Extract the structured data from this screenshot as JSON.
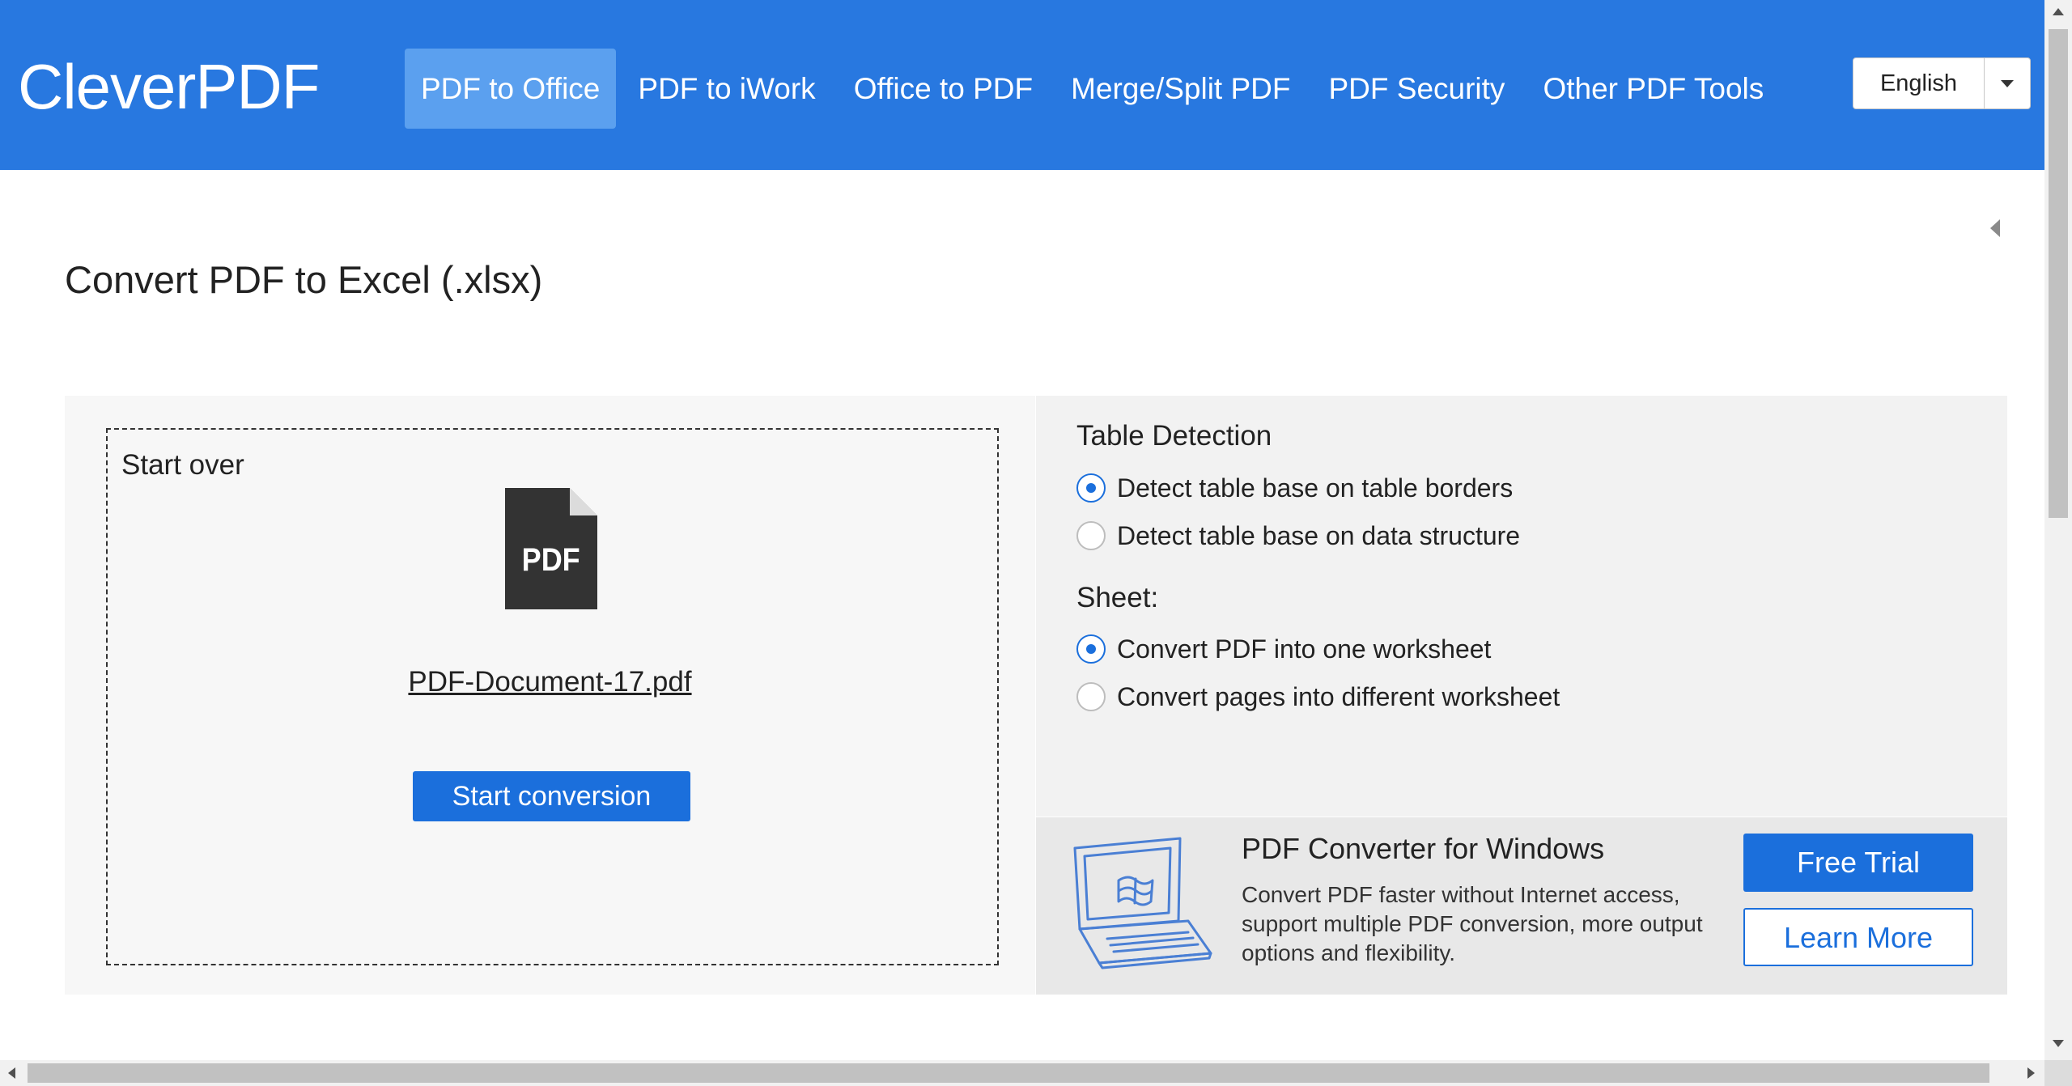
{
  "header": {
    "logo": "CleverPDF",
    "nav": [
      {
        "label": "PDF to Office",
        "active": true
      },
      {
        "label": "PDF to iWork",
        "active": false
      },
      {
        "label": "Office to PDF",
        "active": false
      },
      {
        "label": "Merge/Split PDF",
        "active": false
      },
      {
        "label": "PDF Security",
        "active": false
      },
      {
        "label": "Other PDF Tools",
        "active": false
      }
    ],
    "language": "English",
    "background_color": "#2878e0"
  },
  "page": {
    "title": "Convert PDF to Excel (.xlsx)"
  },
  "upload": {
    "start_over": "Start over",
    "file_icon_label": "PDF",
    "filename": "PDF-Document-17.pdf",
    "start_button": "Start conversion"
  },
  "options": {
    "table_detection": {
      "title": "Table Detection",
      "choices": [
        {
          "label": "Detect table base on table borders",
          "checked": true
        },
        {
          "label": "Detect table base on data structure",
          "checked": false
        }
      ]
    },
    "sheet": {
      "title": "Sheet:",
      "choices": [
        {
          "label": "Convert PDF into one worksheet",
          "checked": true
        },
        {
          "label": "Convert pages into different worksheet",
          "checked": false
        }
      ]
    }
  },
  "promo": {
    "title": "PDF Converter for Windows",
    "description": "Convert PDF faster without Internet access, support multiple PDF conversion, more output options and flexibility.",
    "free_trial": "Free Trial",
    "learn_more": "Learn More"
  },
  "colors": {
    "accent": "#1b6fdc",
    "nav_active": "#5ba0ef"
  }
}
